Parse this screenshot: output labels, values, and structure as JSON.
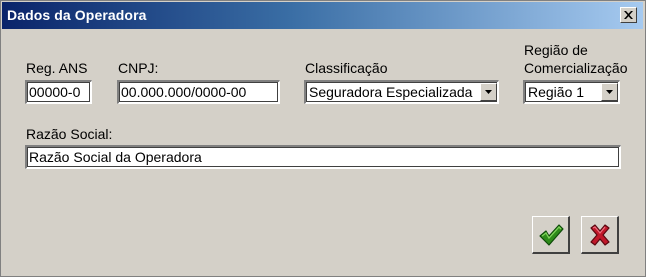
{
  "window": {
    "title": "Dados da Operadora"
  },
  "fields": {
    "reg_ans": {
      "label": "Reg. ANS",
      "value": "00000-0"
    },
    "cnpj": {
      "label": "CNPJ:",
      "value": "00.000.000/0000-00"
    },
    "classificacao": {
      "label": "Classificação",
      "value": "Seguradora Especializada"
    },
    "regiao": {
      "label_line1": "Região de",
      "label_line2": "Comercialização",
      "value": "Região 1"
    },
    "razao_social": {
      "label": "Razão Social:",
      "value": "Razão Social da Operadora"
    }
  },
  "buttons": {
    "ok_icon": "checkmark-icon",
    "cancel_icon": "x-icon"
  },
  "colors": {
    "title_start": "#0a246a",
    "title_end": "#a6caf0",
    "ok_green": "#2e8b1a",
    "cancel_red": "#c0182a"
  }
}
